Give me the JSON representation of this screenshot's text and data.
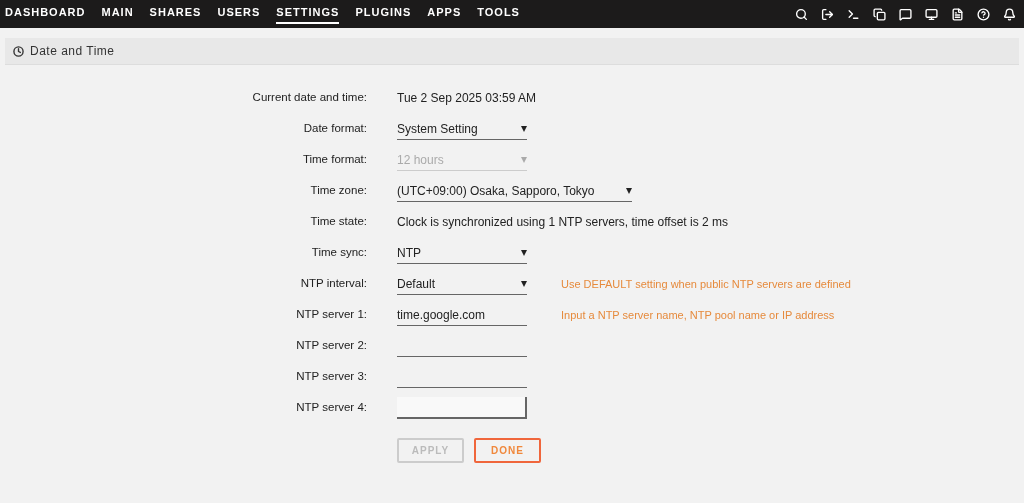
{
  "nav": [
    {
      "label": "DASHBOARD",
      "selected": false
    },
    {
      "label": "MAIN",
      "selected": false
    },
    {
      "label": "SHARES",
      "selected": false
    },
    {
      "label": "USERS",
      "selected": false
    },
    {
      "label": "SETTINGS",
      "selected": true
    },
    {
      "label": "PLUGINS",
      "selected": false
    },
    {
      "label": "APPS",
      "selected": false
    },
    {
      "label": "TOOLS",
      "selected": false
    }
  ],
  "panel": {
    "title": "Date and Time"
  },
  "rows": [
    {
      "label": "Current date and time:",
      "kind": "text",
      "value": "Tue 2 Sep 2025 03:59 AM"
    },
    {
      "label": "Date format:",
      "kind": "select",
      "value": "System Setting",
      "wide": false,
      "disabled": false
    },
    {
      "label": "Time format:",
      "kind": "select",
      "value": "12 hours",
      "wide": false,
      "disabled": true
    },
    {
      "label": "Time zone:",
      "kind": "select",
      "value": "(UTC+09:00) Osaka, Sapporo, Tokyo",
      "wide": true,
      "disabled": false
    },
    {
      "label": "Time state:",
      "kind": "text",
      "value": "Clock is synchronized using 1 NTP servers, time offset is 2 ms"
    },
    {
      "label": "Time sync:",
      "kind": "select",
      "value": "NTP",
      "wide": false,
      "disabled": false
    },
    {
      "label": "NTP interval:",
      "kind": "select",
      "value": "Default",
      "wide": false,
      "disabled": false,
      "hint": "Use DEFAULT setting when public NTP servers are defined"
    },
    {
      "label": "NTP server 1:",
      "kind": "input",
      "value": "time.google.com",
      "focused": false,
      "hint": "Input a NTP server name, NTP pool name or IP address"
    },
    {
      "label": "NTP server 2:",
      "kind": "input",
      "focused": false
    },
    {
      "label": "NTP server 3:",
      "kind": "input",
      "focused": false
    },
    {
      "label": "NTP server 4:",
      "kind": "input",
      "focused": true
    }
  ],
  "buttons": [
    {
      "label": "APPLY",
      "disabled": true
    },
    {
      "label": "DONE",
      "disabled": false
    }
  ]
}
